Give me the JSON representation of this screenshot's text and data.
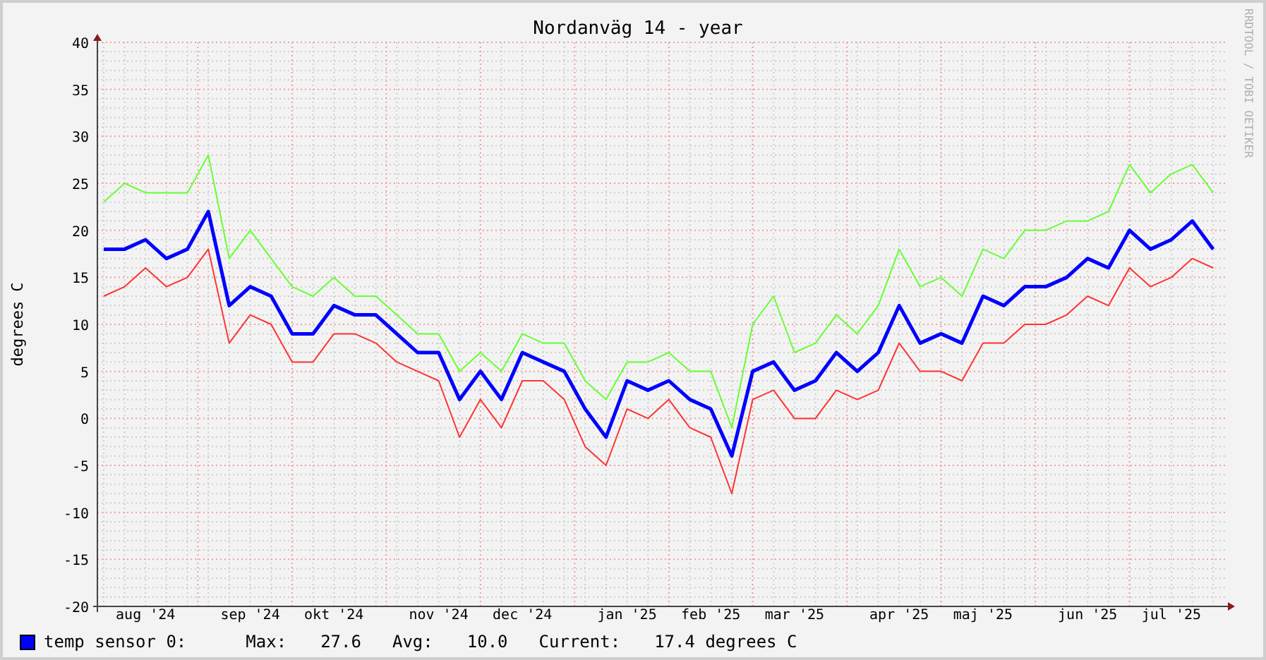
{
  "graph": {
    "title": "Nordanväg 14 - year",
    "watermark": "RRDTOOL / TOBI OETIKER",
    "chart_data": {
      "type": "line",
      "grid": true,
      "ylabel": "degrees C",
      "ylim": [
        -20,
        40
      ],
      "yticks": [
        -20,
        -15,
        -10,
        -5,
        0,
        5,
        10,
        15,
        20,
        25,
        30,
        35,
        40
      ],
      "categories": [
        null,
        null,
        "aug '24",
        null,
        null,
        null,
        null,
        "sep '24",
        null,
        null,
        null,
        "okt '24",
        null,
        null,
        null,
        null,
        "nov '24",
        null,
        null,
        null,
        "dec '24",
        null,
        null,
        null,
        null,
        "jan '25",
        null,
        null,
        null,
        "feb '25",
        null,
        null,
        null,
        "mar '25",
        null,
        null,
        null,
        null,
        "apr '25",
        null,
        null,
        null,
        "maj '25",
        null,
        null,
        null,
        null,
        "jun '25",
        null,
        null,
        null,
        "jul '25",
        null,
        null
      ],
      "series": [
        {
          "color": "#66ff33",
          "values": [
            23,
            25,
            24,
            24,
            24,
            28,
            17,
            20,
            17,
            14,
            13,
            15,
            13,
            13,
            11,
            9,
            9,
            5,
            7,
            5,
            9,
            8,
            8,
            4,
            2,
            6,
            6,
            7,
            5,
            5,
            -1,
            10,
            13,
            7,
            8,
            11,
            9,
            12,
            18,
            14,
            15,
            13,
            18,
            17,
            20,
            20,
            21,
            21,
            22,
            27,
            24,
            26,
            27,
            24
          ]
        },
        {
          "color": "#ff3333",
          "values": [
            13,
            14,
            16,
            14,
            15,
            18,
            8,
            11,
            10,
            6,
            6,
            9,
            9,
            8,
            6,
            5,
            4,
            -2,
            2,
            -1,
            4,
            4,
            2,
            -3,
            -5,
            1,
            0,
            2,
            -1,
            -2,
            -8,
            2,
            3,
            0,
            0,
            3,
            2,
            3,
            8,
            5,
            5,
            4,
            8,
            8,
            10,
            10,
            11,
            13,
            12,
            16,
            14,
            15,
            17,
            16
          ]
        },
        {
          "color": "#0000ff",
          "values": [
            18,
            18,
            19,
            17,
            18,
            22,
            12,
            14,
            13,
            9,
            9,
            12,
            11,
            11,
            9,
            7,
            7,
            2,
            5,
            2,
            7,
            6,
            5,
            1,
            -2,
            4,
            3,
            4,
            2,
            1,
            -4,
            5,
            6,
            3,
            4,
            7,
            5,
            7,
            12,
            8,
            9,
            8,
            13,
            12,
            14,
            14,
            15,
            17,
            16,
            20,
            18,
            19,
            21,
            18
          ]
        }
      ]
    }
  },
  "legend": {
    "color": "#0000ff",
    "label": "temp sensor 0:",
    "max_label": "Max:",
    "max": "27.6",
    "avg_label": "Avg:",
    "avg": "10.0",
    "current_label": "Current:",
    "current": "17.4 degrees C"
  }
}
